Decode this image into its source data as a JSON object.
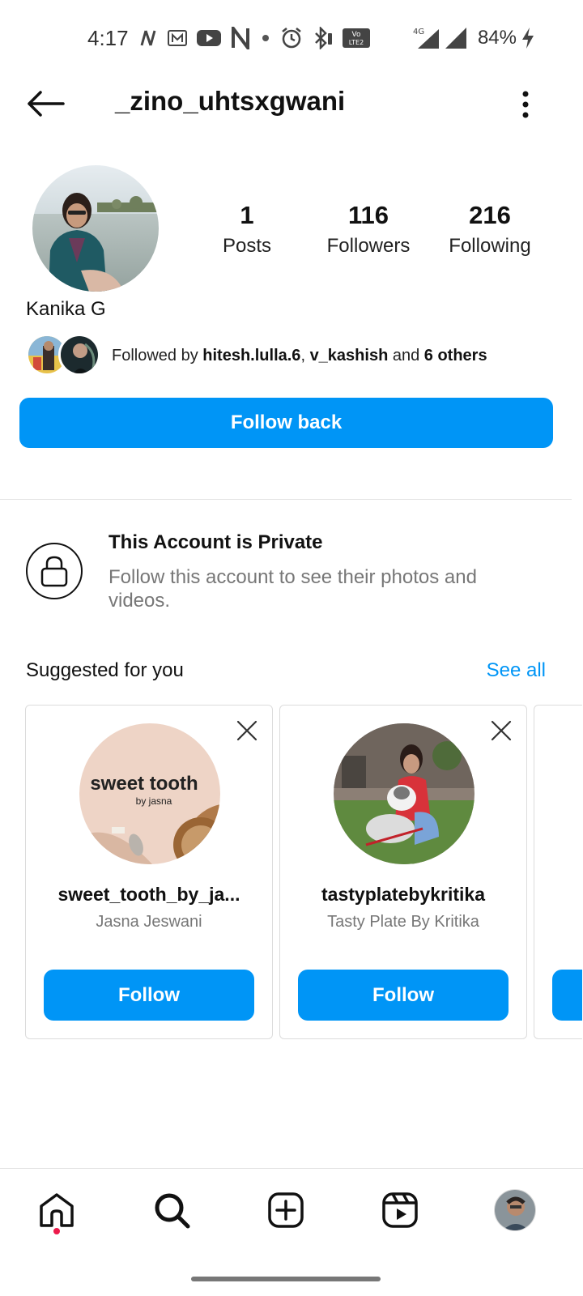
{
  "status_bar": {
    "time": "4:17",
    "network_badge": "Vo LTE 2",
    "network_type": "4G",
    "battery": "84%"
  },
  "header": {
    "username": "_zino_uhtsxgwani"
  },
  "profile": {
    "full_name": "Kanika G",
    "stats": [
      {
        "value": "1",
        "label": "Posts"
      },
      {
        "value": "116",
        "label": "Followers"
      },
      {
        "value": "216",
        "label": "Following"
      }
    ],
    "followed_by": {
      "prefix": "Followed by ",
      "user1": "hitesh.lulla.6",
      "separator": ", ",
      "user2": "v_kashish",
      "and": " and ",
      "others": "6 others"
    },
    "follow_back_label": "Follow back"
  },
  "private": {
    "title": "This Account is Private",
    "description": "Follow this account to see their photos and videos."
  },
  "suggested": {
    "title": "Suggested for you",
    "see_all": "See all",
    "cards": [
      {
        "username": "sweet_tooth_by_ja...",
        "name": "Jasna Jeswani",
        "follow_label": "Follow",
        "avatar_line1": "sweet tooth",
        "avatar_line2": "by jasna"
      },
      {
        "username": "tastyplatebykritika",
        "name": "Tasty Plate By Kritika",
        "follow_label": "Follow"
      }
    ]
  },
  "colors": {
    "accent": "#0095f6",
    "notification_dot": "#ed1a4b"
  },
  "nav": {
    "items": [
      "home-icon",
      "search-icon",
      "create-icon",
      "reels-icon",
      "profile-avatar"
    ]
  }
}
